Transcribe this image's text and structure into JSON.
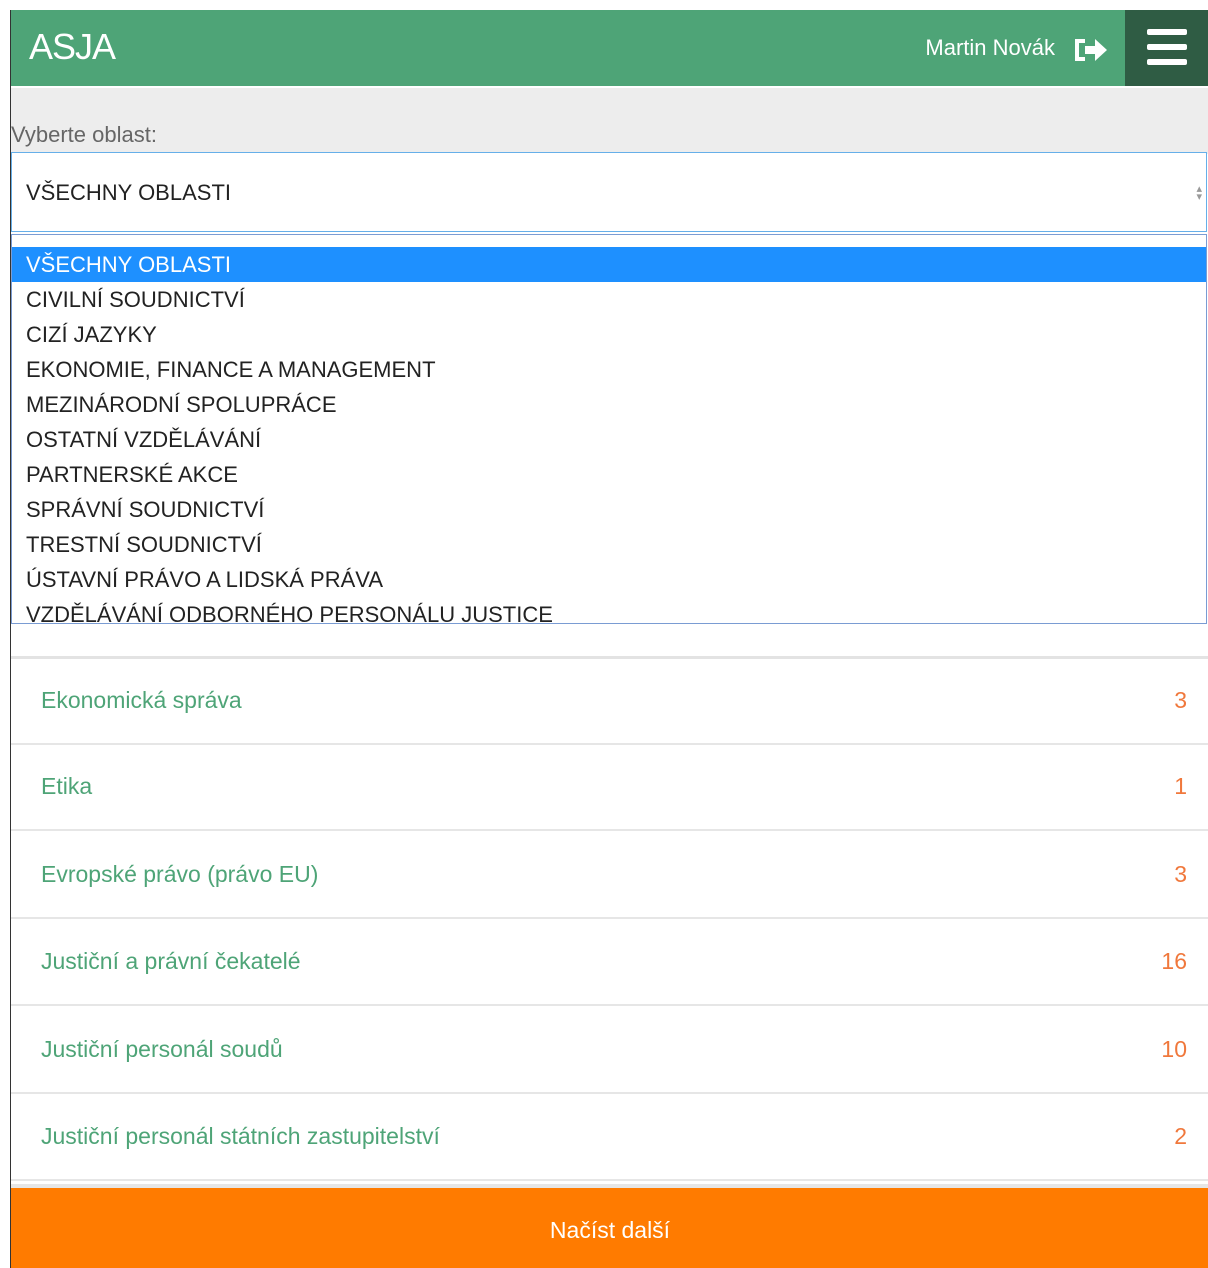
{
  "header": {
    "app_title": "ASJA",
    "user_name": "Martin Novák",
    "logout_icon": "logout-icon",
    "menu_icon": "hamburger-menu-icon",
    "colors": {
      "header_bg": "#4ea477",
      "menu_bg": "#2f5c44"
    }
  },
  "filter": {
    "label": "Vyberte oblast:",
    "selected_value": "VŠECHNY OBLASTI",
    "options": [
      "VŠECHNY OBLASTI",
      "CIVILNÍ SOUDNICTVÍ",
      "CIZÍ JAZYKY",
      "EKONOMIE, FINANCE A MANAGEMENT",
      "MEZINÁRODNÍ SPOLUPRÁCE",
      "OSTATNÍ VZDĚLÁVÁNÍ",
      "PARTNERSKÉ AKCE",
      "SPRÁVNÍ SOUDNICTVÍ",
      "TRESTNÍ SOUDNICTVÍ",
      "ÚSTAVNÍ PRÁVO A LIDSKÁ PRÁVA",
      "VZDĚLÁVÁNÍ ODBORNÉHO PERSONÁLU JUSTICE"
    ]
  },
  "topics": [
    {
      "label": "Ekonomická správa",
      "count": "3"
    },
    {
      "label": "Etika",
      "count": "1"
    },
    {
      "label": "Evropské právo (právo EU)",
      "count": "3"
    },
    {
      "label": "Justiční a právní čekatelé",
      "count": "16"
    },
    {
      "label": "Justiční personál soudů",
      "count": "10"
    },
    {
      "label": "Justiční personál státních zastupitelství",
      "count": "2"
    }
  ],
  "load_more_label": "Načíst další",
  "colors": {
    "accent_green": "#4ea477",
    "count_orange": "#f0783c",
    "button_orange": "#ff7b00",
    "selected_blue": "#1e90ff"
  }
}
